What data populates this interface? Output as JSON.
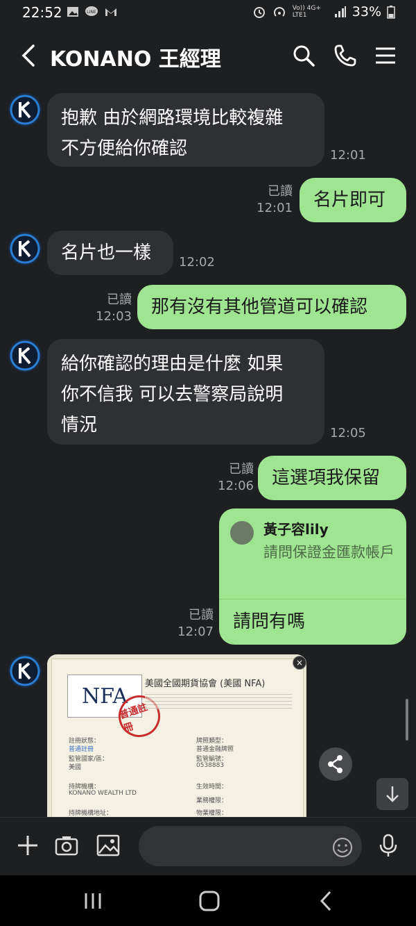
{
  "status": {
    "time": "22:52",
    "left_icons": [
      "gallery-icon",
      "line-icon",
      "gmail-icon"
    ],
    "right_icons": [
      "alarm-icon",
      "hotspot-icon",
      "volte-icon",
      "signal-icon"
    ],
    "volte": "Vo)) 4G+ LTE1",
    "battery": "33%"
  },
  "header": {
    "title": "KONANO 王經理",
    "icons": [
      "search-icon",
      "phone-icon",
      "menu-icon"
    ]
  },
  "messages": [
    {
      "dir": "in",
      "lines": [
        "抱歉 由於網路環境比較複雜",
        "不方便給你確認"
      ],
      "time": "12:01"
    },
    {
      "dir": "out",
      "lines": [
        "名片即可"
      ],
      "read": "已讀",
      "time": "12:01"
    },
    {
      "dir": "in",
      "lines": [
        "名片也一樣"
      ],
      "time": "12:02"
    },
    {
      "dir": "out",
      "lines": [
        "那有沒有其他管道可以確認"
      ],
      "read": "已讀",
      "time": "12:03"
    },
    {
      "dir": "in",
      "lines": [
        "給你確認的理由是什麼 如果",
        "你不信我 可以去警察局說明",
        "情況"
      ],
      "time": "12:05"
    },
    {
      "dir": "out",
      "lines": [
        "這選項我保留"
      ],
      "read": "已讀",
      "time": "12:06"
    }
  ],
  "reply": {
    "quoted_name": "黃子容lily",
    "quoted_text": "請問保證金匯款帳戶",
    "text": "請問有嗎",
    "read": "已讀",
    "time": "12:07"
  },
  "image_message": {
    "logo_text": "NFA",
    "stamp_text": "普通註冊",
    "title": "美國全國期貨協會 (美國 NFA)",
    "fields_left": [
      "註冊狀態：",
      "監管國家/區：",
      "持牌機構：",
      "持牌機構地址："
    ],
    "fields_right": [
      "牌照類型：",
      "監管編號：",
      "生效時間：",
      "業務權限：",
      "物業權限："
    ],
    "values_left": [
      "普通註冊",
      "美國",
      "KONANO WEALTH LTD"
    ],
    "values_right": [
      "普通金融牌照",
      "0538883"
    ]
  },
  "input": {
    "placeholder": "",
    "icons": [
      "plus-icon",
      "camera-icon",
      "image-icon",
      "emoji-icon",
      "mic-icon"
    ]
  },
  "navbar": {
    "icons": [
      "recents-icon",
      "home-icon",
      "back-icon"
    ]
  },
  "colors": {
    "background": "#1e1f21",
    "incoming_bubble": "#2f3033",
    "outgoing_bubble": "#9ee491",
    "meta_text": "#a7a8ab"
  }
}
